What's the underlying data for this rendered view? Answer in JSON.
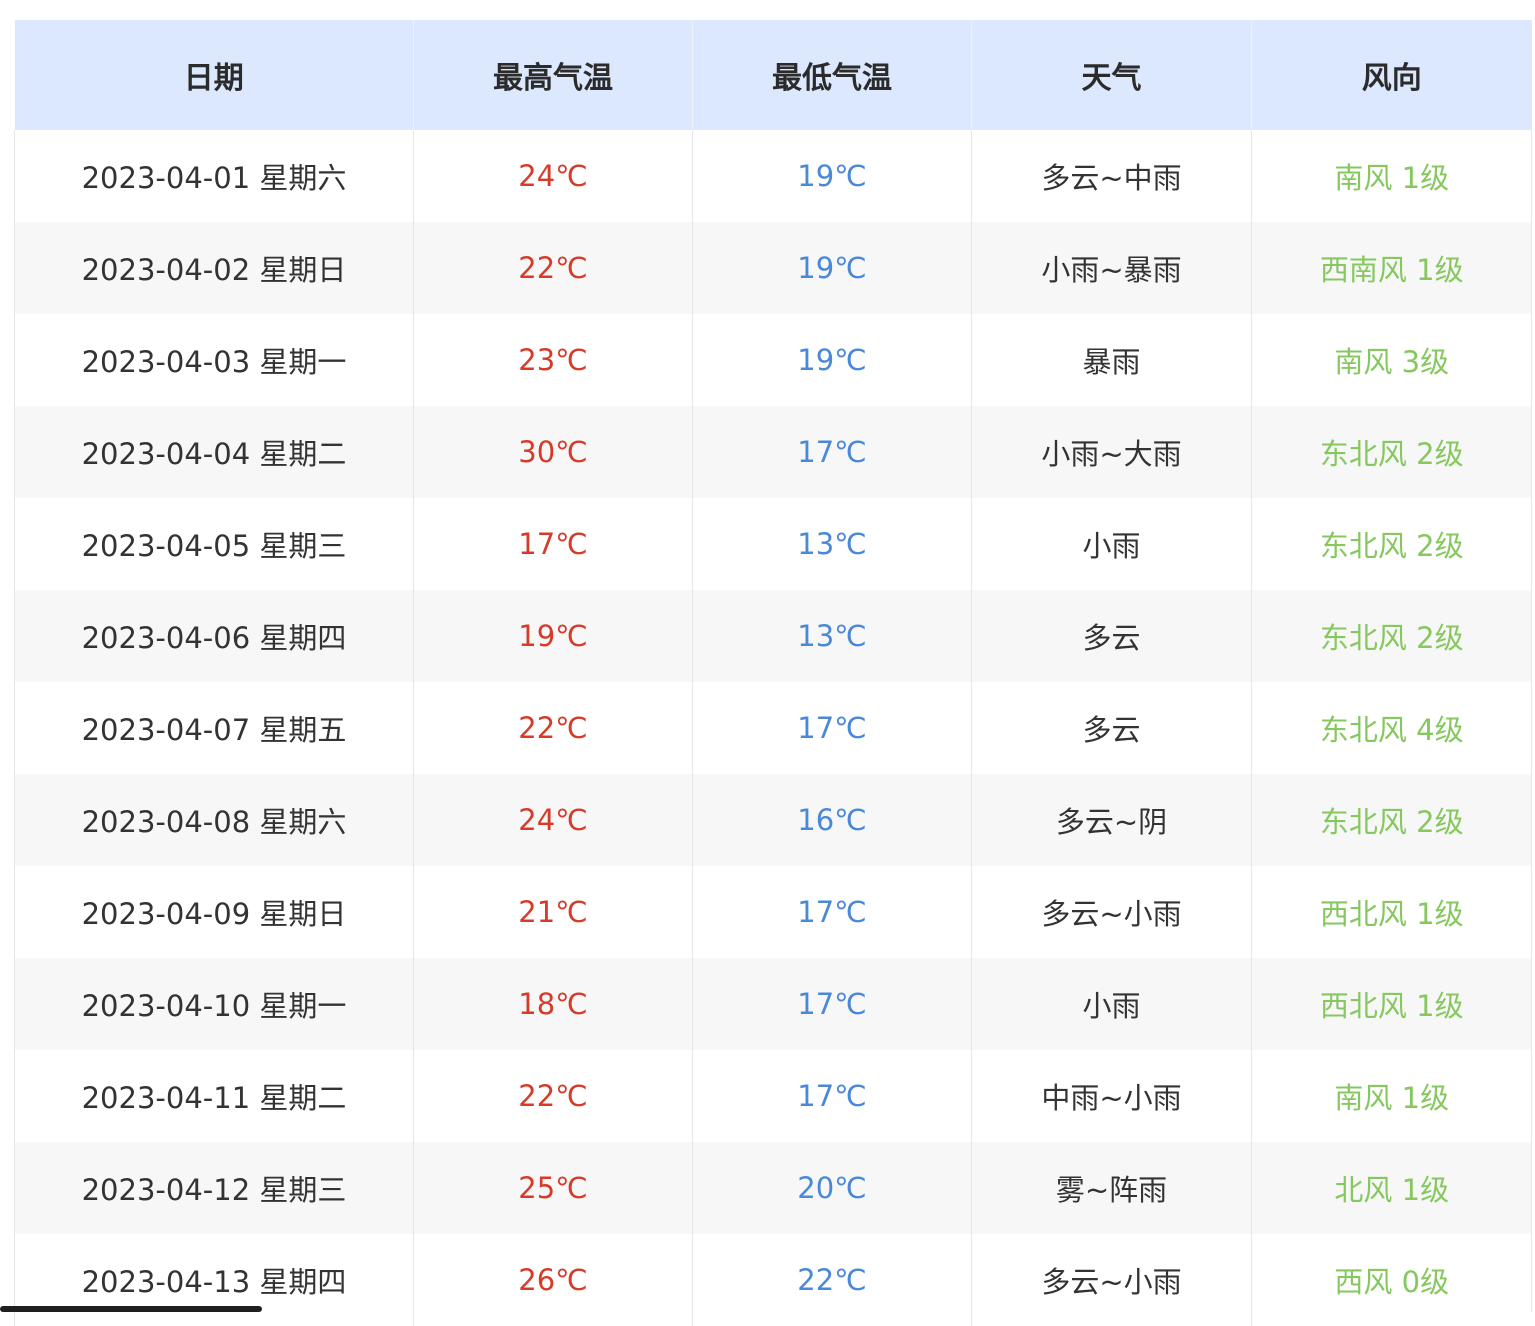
{
  "table": {
    "headers": [
      "日期",
      "最高气温",
      "最低气温",
      "天气",
      "风向"
    ],
    "rows": [
      {
        "date": "2023-04-01 星期六",
        "high": "24℃",
        "low": "19℃",
        "weather": "多云~中雨",
        "wind": "南风 1级"
      },
      {
        "date": "2023-04-02 星期日",
        "high": "22℃",
        "low": "19℃",
        "weather": "小雨~暴雨",
        "wind": "西南风 1级"
      },
      {
        "date": "2023-04-03 星期一",
        "high": "23℃",
        "low": "19℃",
        "weather": "暴雨",
        "wind": "南风 3级"
      },
      {
        "date": "2023-04-04 星期二",
        "high": "30℃",
        "low": "17℃",
        "weather": "小雨~大雨",
        "wind": "东北风 2级"
      },
      {
        "date": "2023-04-05 星期三",
        "high": "17℃",
        "low": "13℃",
        "weather": "小雨",
        "wind": "东北风 2级"
      },
      {
        "date": "2023-04-06 星期四",
        "high": "19℃",
        "low": "13℃",
        "weather": "多云",
        "wind": "东北风 2级"
      },
      {
        "date": "2023-04-07 星期五",
        "high": "22℃",
        "low": "17℃",
        "weather": "多云",
        "wind": "东北风 4级"
      },
      {
        "date": "2023-04-08 星期六",
        "high": "24℃",
        "low": "16℃",
        "weather": "多云~阴",
        "wind": "东北风 2级"
      },
      {
        "date": "2023-04-09 星期日",
        "high": "21℃",
        "low": "17℃",
        "weather": "多云~小雨",
        "wind": "西北风 1级"
      },
      {
        "date": "2023-04-10 星期一",
        "high": "18℃",
        "low": "17℃",
        "weather": "小雨",
        "wind": "西北风 1级"
      },
      {
        "date": "2023-04-11 星期二",
        "high": "22℃",
        "low": "17℃",
        "weather": "中雨~小雨",
        "wind": "南风 1级"
      },
      {
        "date": "2023-04-12 星期三",
        "high": "25℃",
        "low": "20℃",
        "weather": "雾~阵雨",
        "wind": "北风 1级"
      },
      {
        "date": "2023-04-13 星期四",
        "high": "26℃",
        "low": "22℃",
        "weather": "多云~小雨",
        "wind": "西风 0级"
      }
    ]
  },
  "colors": {
    "header_bg": "#dce8fd",
    "high_temp": "#d63b2a",
    "low_temp": "#4a88d8",
    "wind": "#86c85f",
    "text": "#333333"
  }
}
